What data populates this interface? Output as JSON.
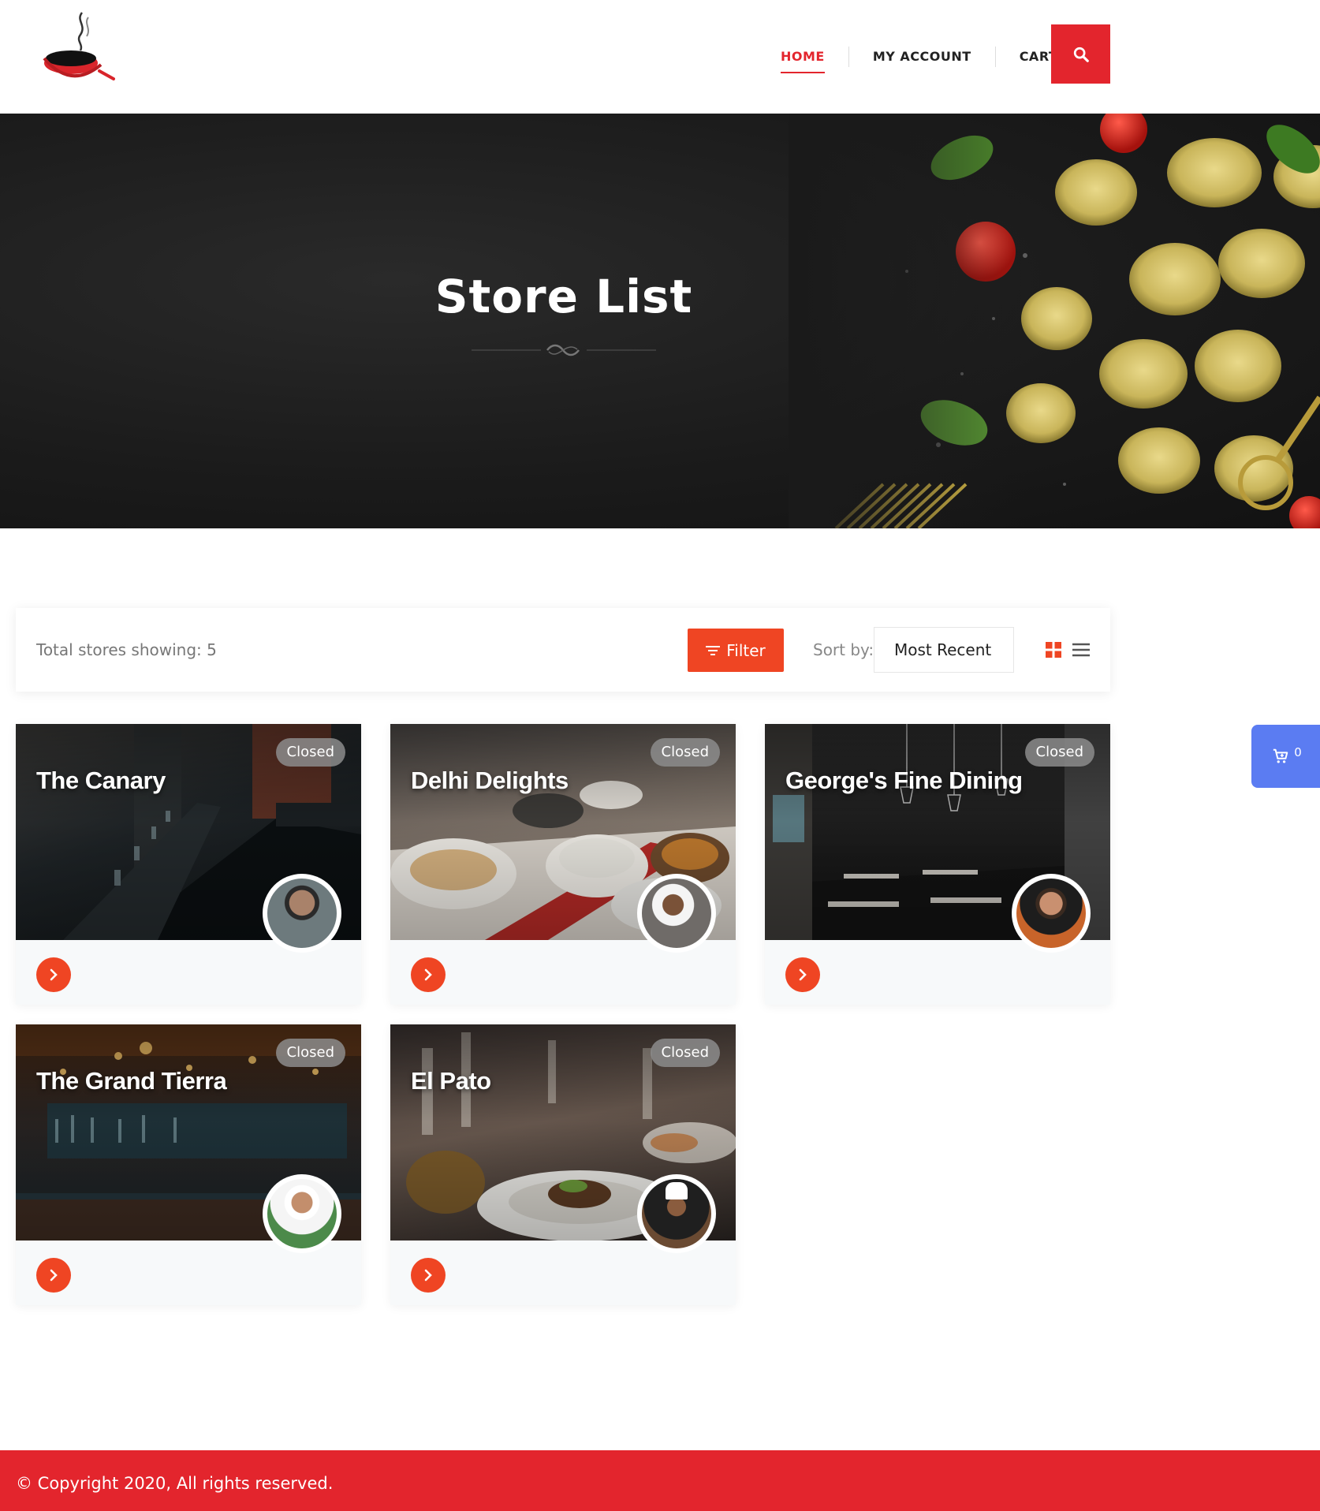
{
  "header": {
    "nav": [
      {
        "label": "HOME",
        "active": true
      },
      {
        "label": "MY ACCOUNT",
        "active": false
      },
      {
        "label": "CART",
        "active": false
      }
    ],
    "search_icon": "search-icon",
    "logo_icon": "steaming-pan-logo"
  },
  "hero": {
    "title": "Store List"
  },
  "toolbar": {
    "total_label": "Total stores showing: 5",
    "filter_label": "Filter",
    "sort_label": "Sort by:",
    "sort_value": "Most Recent",
    "view_modes": [
      "grid-view-icon",
      "list-view-icon"
    ],
    "active_view": "grid"
  },
  "stores": [
    {
      "name": "The Canary",
      "status": "Closed"
    },
    {
      "name": "Delhi Delights",
      "status": "Closed"
    },
    {
      "name": "George's Fine Dining",
      "status": "Closed"
    },
    {
      "name": "The Grand Tierra",
      "status": "Closed"
    },
    {
      "name": "El Pato",
      "status": "Closed"
    }
  ],
  "cart_float": {
    "count": "0",
    "icon": "cart-icon"
  },
  "footer": {
    "copyright": "© Copyright 2020, All rights reserved."
  },
  "colors": {
    "brand_red": "#e3252d",
    "accent_orange": "#ef4523",
    "cart_blue": "#5b7cf2"
  }
}
